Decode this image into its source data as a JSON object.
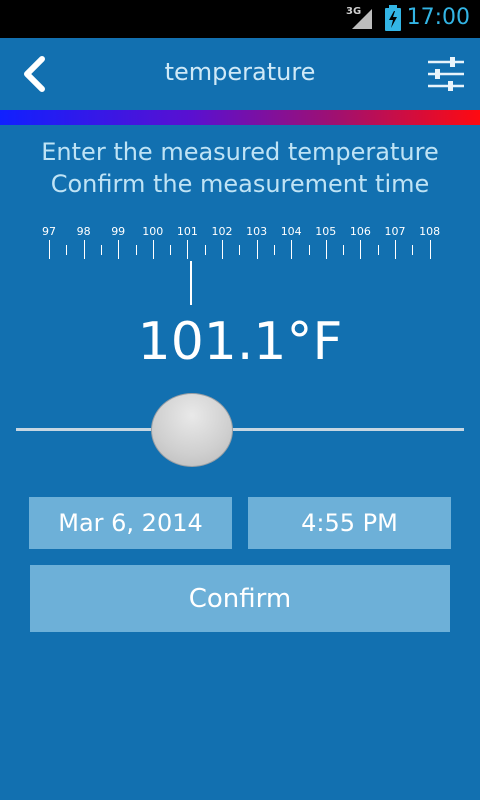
{
  "status_bar": {
    "network": "3G",
    "time": "17:00",
    "icons": [
      "signal-icon",
      "battery-charging-icon"
    ]
  },
  "action_bar": {
    "title": "temperature",
    "back_icon": "chevron-left-icon",
    "settings_icon": "sliders-icon"
  },
  "gradient": {
    "colors": [
      "#1020ff",
      "#5a10d0",
      "#a01070",
      "#ff0a10"
    ]
  },
  "instructions": {
    "line1": "Enter the measured temperature",
    "line2": "Confirm the measurement time"
  },
  "ruler": {
    "labels": [
      "97",
      "98",
      "99",
      "100",
      "101",
      "102",
      "103",
      "104",
      "105",
      "106",
      "107",
      "108"
    ]
  },
  "reading": {
    "value": "101.1°F"
  },
  "date_button": {
    "label": "Mar 6, 2014"
  },
  "time_button": {
    "label": "4:55 PM"
  },
  "confirm_button": {
    "label": "Confirm"
  },
  "colors": {
    "background": "#1270b0",
    "button": "#6db0d8",
    "status_time": "#33b5e5"
  }
}
